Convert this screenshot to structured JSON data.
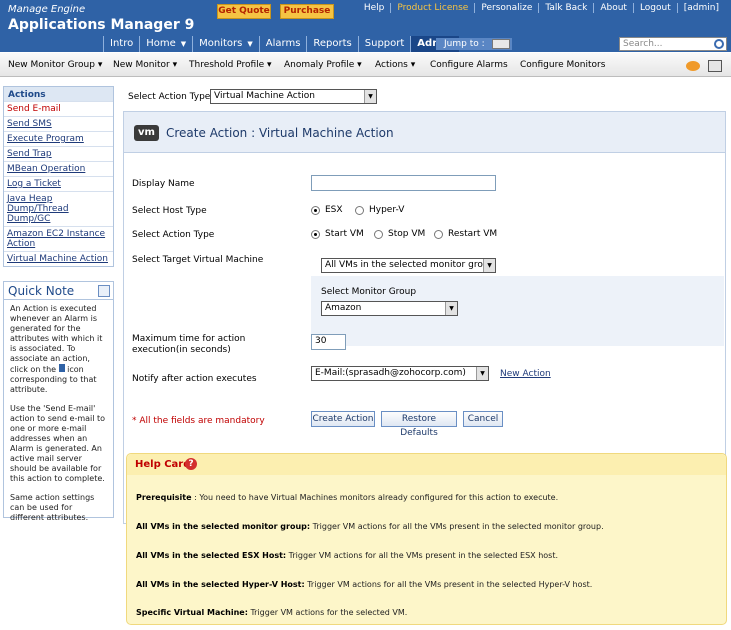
{
  "header": {
    "brand_top": "Manage Engine",
    "brand_app": "Applications Manager 9",
    "get_quote": "Get Quote",
    "purchase": "Purchase",
    "links": [
      "Help",
      "Product License",
      "Personalize",
      "Talk Back",
      "About",
      "Logout",
      "[admin]"
    ]
  },
  "nav": {
    "tabs": [
      "Intro",
      "Home",
      "Monitors",
      "Alarms",
      "Reports",
      "Support",
      "Admin"
    ],
    "jump_to": "Jump to :",
    "search_placeholder": "Search..."
  },
  "menu": [
    "New Monitor Group ▾",
    "New Monitor ▾",
    "Threshold Profile ▾",
    "Anomaly Profile ▾",
    "Actions ▾",
    "Configure Alarms",
    "Configure Monitors"
  ],
  "sidebar": {
    "title": "Actions",
    "items": [
      "Send E-mail",
      "Send SMS",
      "Execute Program",
      "Send Trap",
      "MBean Operation",
      "Log a Ticket",
      "Java Heap Dump/Thread Dump/GC",
      "Amazon EC2 Instance Action",
      "Virtual Machine Action"
    ]
  },
  "quick_note": {
    "title": "Quick Note",
    "p1": "An Action is executed whenever an Alarm is generated for the attributes with which it is associated. To associate an action, click on the",
    "p1b": "icon corresponding to that attribute.",
    "p2": "Use the 'Send E-mail' action to send e-mail to one or more e-mail addresses when an Alarm is generated. An active mail server should be available for this action to complete.",
    "p3": "Same action settings can be used for different attributes."
  },
  "form": {
    "select_action_type_label": "Select Action Type",
    "select_action_type_value": "Virtual Machine Action",
    "badge": "vm",
    "title": "Create Action : Virtual Machine Action",
    "display_name_label": "Display Name",
    "display_name_value": "",
    "host_type_label": "Select Host Type",
    "host_types": [
      "ESX",
      "Hyper-V"
    ],
    "action_type_label": "Select Action Type",
    "action_types": [
      "Start VM",
      "Stop VM",
      "Restart VM"
    ],
    "target_label": "Select Target Virtual Machine",
    "target_value": "All VMs in the selected monitor group",
    "monitor_group_label": "Select Monitor Group",
    "monitor_group_value": "Amazon",
    "max_time_label": "Maximum time for action execution(in seconds)",
    "max_time_value": "30",
    "notify_label": "Notify after action executes",
    "notify_value": "E-Mail:(sprasadh@zohocorp.com)",
    "new_action": "New Action",
    "mandatory": "* All the fields are mandatory",
    "buttons": [
      "Create Action",
      "Restore Defaults",
      "Cancel"
    ]
  },
  "help": {
    "title": "Help Card",
    "items": [
      {
        "b": "Prerequisite",
        "t": " : You need to have Virtual Machines monitors already configured for this action to execute."
      },
      {
        "b": "All VMs in the selected monitor group:",
        "t": " Trigger VM actions for all the VMs present in the selected monitor group."
      },
      {
        "b": "All VMs in the selected ESX Host:",
        "t": " Trigger VM actions for all the VMs present in the selected ESX host."
      },
      {
        "b": "All VMs in the selected Hyper-V Host:",
        "t": " Trigger VM actions for all the VMs present in the selected Hyper-V host."
      },
      {
        "b": "Specific Virtual Machine:",
        "t": " Trigger VM actions for the selected VM."
      }
    ]
  },
  "colors": {
    "header_blue": "#2f62a6",
    "accent_orange": "#f6c343",
    "link": "#1e3a7a",
    "required_red": "#c00000",
    "help_bg": "#fdf6c9"
  }
}
